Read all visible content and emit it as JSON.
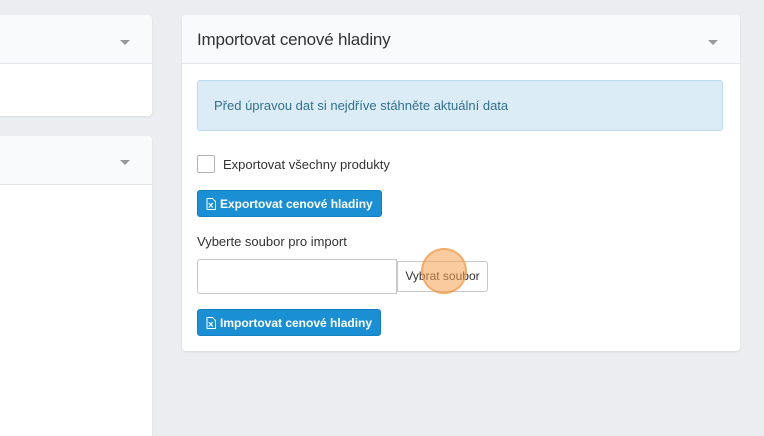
{
  "panel": {
    "title": "Importovat cenové hladiny",
    "alert_text": "Před úpravou dat si nejdříve stáhněte aktuální data",
    "export_all_label": "Exportovat všechny produkty",
    "export_button_label": "Exportovat cenové hladiny",
    "file_label": "Vyberte soubor pro import",
    "file_input_value": "",
    "choose_file_label": "Vybrat soubor",
    "import_button_label": "Importovat cenové hladiny"
  },
  "icons": {
    "collapse": "chevron-down-icon",
    "file": "excel-file-icon"
  },
  "colors": {
    "primary": "#1b8fd3",
    "alert_bg": "#dbecf6",
    "alert_text": "#31708f",
    "background": "#ebedf1"
  }
}
